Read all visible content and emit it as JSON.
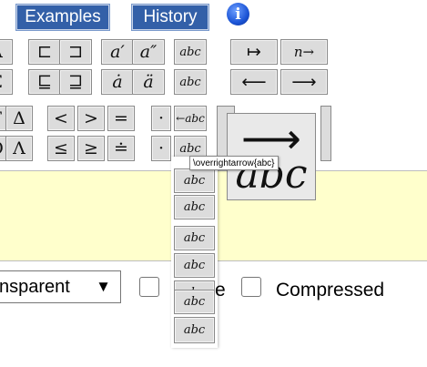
{
  "toolbar": {
    "examples_label": "Examples",
    "history_label": "History",
    "info_label": "i"
  },
  "symbols": {
    "row1": [
      "Λ",
      "⊏",
      "⊐",
      "a′",
      "a″",
      "abc",
      "↦",
      "n→"
    ],
    "row2": [
      "Ξ",
      "⊑",
      "⊒",
      "ȧ",
      "ä",
      "abc",
      "⟵",
      "⟶"
    ],
    "row3": [
      "Γ",
      "Δ",
      "<",
      ">",
      "=",
      "·",
      "←abc"
    ],
    "row4": [
      "Θ",
      "Λ",
      "≤",
      "≥",
      "≐",
      "·",
      "abc"
    ]
  },
  "dropdown_symbols": [
    "abc",
    "abc",
    "abc",
    "abc",
    "abc",
    "abc",
    "abc",
    "abc"
  ],
  "preview": {
    "arrow": "⟶",
    "text": "abc"
  },
  "tooltip": "\\overrightarrow{abc}",
  "options": {
    "background_value": "nsparent",
    "background_arrow": "▼",
    "transparent_partial_label": "e",
    "compressed_label": "Compressed"
  }
}
